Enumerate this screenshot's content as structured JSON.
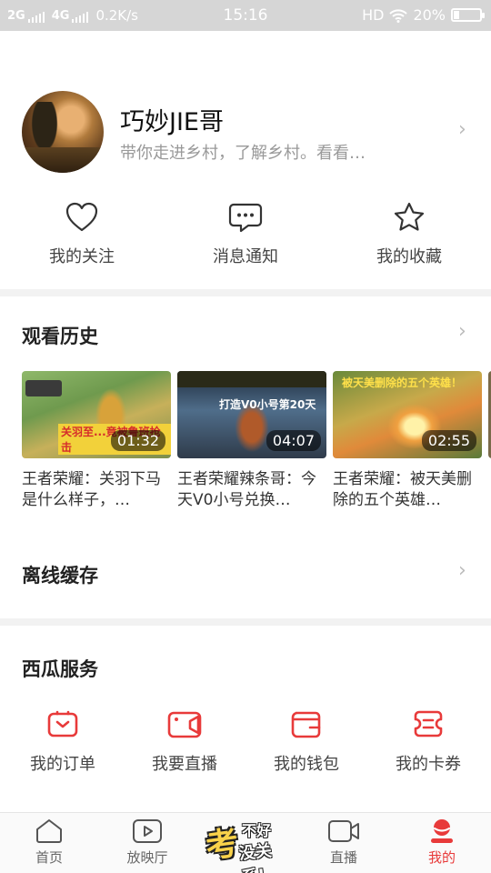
{
  "status_bar": {
    "net1": "2G",
    "net2": "4G",
    "speed": "0.2K/s",
    "time": "15:16",
    "hd": "HD",
    "battery": "20%",
    "battery_level": 0.2
  },
  "profile": {
    "name": "巧妙JIE哥",
    "description": "带你走进乡村，了解乡村。看看…"
  },
  "quick_actions": [
    {
      "label": "我的关注",
      "icon": "heart-icon"
    },
    {
      "label": "消息通知",
      "icon": "message-icon"
    },
    {
      "label": "我的收藏",
      "icon": "star-icon"
    }
  ],
  "history": {
    "title": "观看历史",
    "videos": [
      {
        "title": "王者荣耀：关羽下马是什么样子，…",
        "duration": "01:32",
        "banner": "关羽至...竟被鲁班抢击"
      },
      {
        "title": "王者荣耀辣条哥：今天V0小号兑换…",
        "duration": "04:07",
        "banner": "打造V0小号第20天"
      },
      {
        "title": "王者荣耀：被天美删除的五个英雄…",
        "duration": "02:55",
        "banner": "被天美删除的五个英雄！"
      }
    ]
  },
  "offline": {
    "title": "离线缓存"
  },
  "services": {
    "title": "西瓜服务",
    "items": [
      {
        "label": "我的订单",
        "icon": "order-icon"
      },
      {
        "label": "我要直播",
        "icon": "live-camera-icon"
      },
      {
        "label": "我的钱包",
        "icon": "wallet-icon"
      },
      {
        "label": "我的卡券",
        "icon": "coupon-icon"
      }
    ]
  },
  "bottom_nav": {
    "items": [
      {
        "label": "首页",
        "icon": "home-icon"
      },
      {
        "label": "放映厅",
        "icon": "play-icon"
      },
      {
        "label": "直播",
        "icon": "video-camera-icon"
      },
      {
        "label": "我的",
        "icon": "profile-icon"
      }
    ],
    "center_logo": {
      "line1": "考",
      "line2": "不好",
      "line3": "没关系!"
    }
  },
  "colors": {
    "accent": "#e83a3a",
    "icon_gray": "#555555",
    "divider": "#f2f2f2"
  }
}
